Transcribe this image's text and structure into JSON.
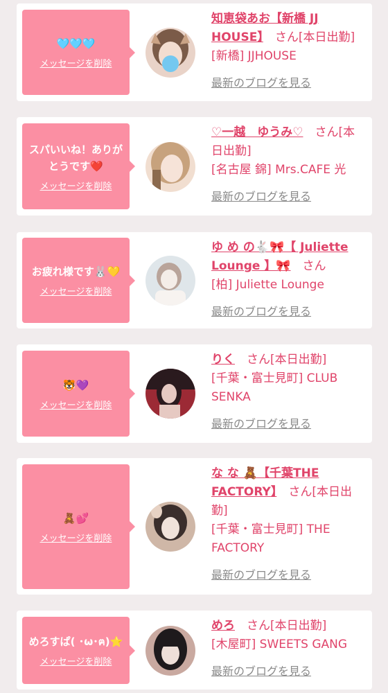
{
  "cards": [
    {
      "message": "🩵🩵🩵",
      "delete_label": "メッセージを削除",
      "name": "知恵袋あお【新橋 JJ HOUSE】",
      "san": "さん",
      "status": "[本日出勤]",
      "shop": "[新橋] JJHOUSE",
      "blog_label": "最新のブログを見る",
      "avatar_colors": [
        "#caa385",
        "#7b5b48",
        "#e9d3c8"
      ]
    },
    {
      "message": "スパいいね！ありがとうです❤️",
      "delete_label": "メッセージを削除",
      "name": "♡一越　ゆうみ♡",
      "san": "さん",
      "status": "[本日出勤]",
      "shop": "[名古屋 錦] Mrs.CAFE 光",
      "blog_label": "最新のブログを見る",
      "avatar_colors": [
        "#c7a27d",
        "#8b6a4e",
        "#f1ded0"
      ]
    },
    {
      "message": "お疲れ様です🐰💛",
      "delete_label": "メッセージを削除",
      "name": "ゆ め の🐇🎀【 Juliette Lounge 】🎀",
      "san": "さん",
      "status": "",
      "shop": "[柏] Juliette Lounge",
      "blog_label": "最新のブログを見る",
      "avatar_colors": [
        "#dfe6ea",
        "#b9a49a",
        "#f4ede8"
      ]
    },
    {
      "message": "🐯💜",
      "delete_label": "メッセージを削除",
      "name": "りく",
      "san": "さん",
      "status": "[本日出勤]",
      "shop": "[千葉・富士見町] CLUB SENKA",
      "blog_label": "最新のブログを見る",
      "avatar_colors": [
        "#2a1a1e",
        "#9c2a35",
        "#e6c9c2"
      ]
    },
    {
      "message": "🧸💕",
      "delete_label": "メッセージを削除",
      "name": "な な 🧸【千葉THE FACTORY】",
      "san": "さん",
      "status": "[本日出勤]",
      "shop": "[千葉・富士見町] THE FACTORY",
      "blog_label": "最新のブログを見る",
      "avatar_colors": [
        "#3a2e2c",
        "#cfb7a7",
        "#f0e2da"
      ]
    },
    {
      "message": "めろすぱ( ･ω･ฅ)⭐️",
      "delete_label": "メッセージを削除",
      "name": "めろ",
      "san": "さん",
      "status": "[本日出勤]",
      "shop": "[木屋町] SWEETS GANG",
      "blog_label": "最新のブログを見る",
      "avatar_colors": [
        "#1e1a1c",
        "#c9a9a0",
        "#eedfd8"
      ]
    }
  ]
}
